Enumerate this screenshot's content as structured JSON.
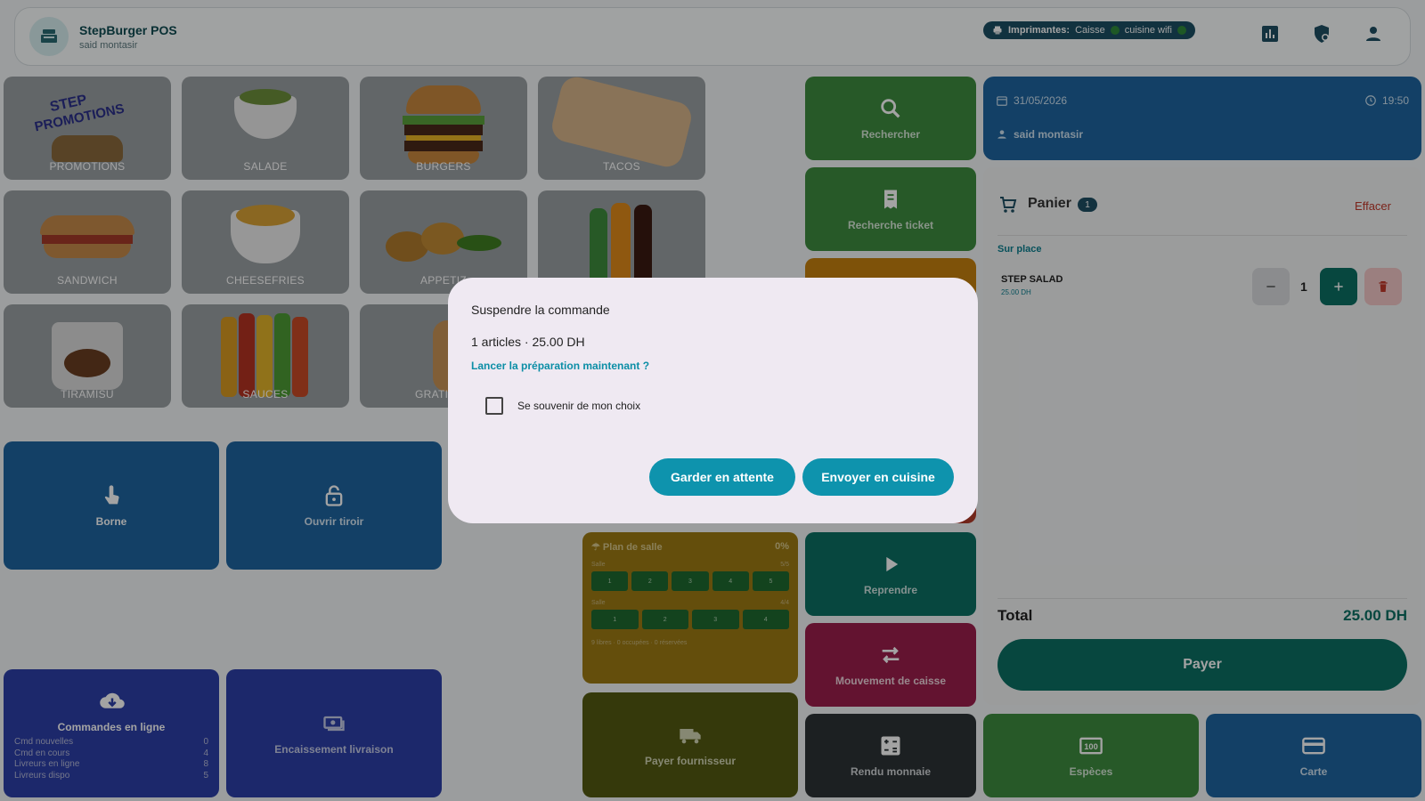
{
  "app": {
    "title": "StepBurger POS",
    "user": "said montasir"
  },
  "printers": {
    "label": "Imprimantes:",
    "items": [
      "Caisse",
      "cuisine wifi"
    ],
    "status_color": "#2f8a3a"
  },
  "header_icons": [
    "chart-icon",
    "shield-icon",
    "account-icon"
  ],
  "categories": [
    "PROMOTIONS",
    "SALADE",
    "BURGERS",
    "TACOS",
    "SANDWICH",
    "CHEESEFRIES",
    "APPETIZ",
    "",
    "TIRAMISU",
    "SAUCES",
    "GRATI"
  ],
  "promo_art_text": [
    "STEP",
    "PROMOTIONS"
  ],
  "actions": {
    "borne": "Borne",
    "ouvrir_tiroir": "Ouvrir tiroir",
    "rechercher": "Rechercher",
    "recherche_ticket": "Recherche ticket",
    "reprendre": "Reprendre",
    "mouvement": "Mouvement de caisse",
    "payer_fournisseur": "Payer fournisseur",
    "rendu_monnaie": "Rendu monnaie",
    "especes": "Espèces",
    "carte": "Carte",
    "encaissement": "Encaissement livraison",
    "commandes": "Commandes en ligne"
  },
  "online_orders": [
    {
      "label": "Cmd nouvelles",
      "value": "0"
    },
    {
      "label": "Cmd en cours",
      "value": "4"
    },
    {
      "label": "Livreurs en ligne",
      "value": "8"
    },
    {
      "label": "Livreurs dispo",
      "value": "5"
    }
  ],
  "plan": {
    "title": "Plan de salle",
    "percent": "0%",
    "rooms": [
      {
        "name": "Salle",
        "count": "5/5",
        "tables": [
          "1",
          "2",
          "3",
          "4",
          "5"
        ]
      },
      {
        "name": "Salle",
        "count": "4/4",
        "tables": [
          "1",
          "2",
          "3",
          "4"
        ]
      }
    ],
    "footer": "9 libres · 0 occupées · 0 réservées"
  },
  "session": {
    "date": "31/05/2026",
    "time": "19:50",
    "user": "said montasir"
  },
  "cart": {
    "title": "Panier",
    "count": "1",
    "clear": "Effacer",
    "mode": "Sur place",
    "items": [
      {
        "name": "STEP SALAD",
        "price": "25.00 DH",
        "qty": "1"
      }
    ],
    "total_label": "Total",
    "total": "25.00 DH",
    "pay": "Payer"
  },
  "modal": {
    "title": "Suspendre la commande",
    "summary": "1 articles · 25.00 DH",
    "question": "Lancer la préparation maintenant ?",
    "remember": "Se souvenir de mon choix",
    "hold": "Garder en attente",
    "send": "Envoyer en cuisine"
  },
  "colors": {
    "green": "#3d8b3f",
    "teal": "#0b6f63",
    "blue": "#1e65a0",
    "navy": "#2c3fa8",
    "crimson": "#9c1e4c",
    "olive": "#535a12",
    "dark": "#2c3236",
    "accent": "#0e93ad"
  }
}
